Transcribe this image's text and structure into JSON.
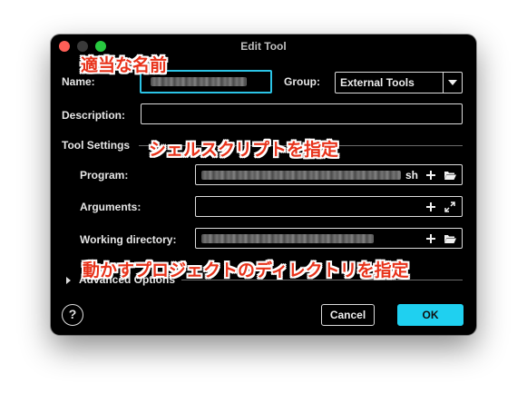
{
  "window": {
    "title": "Edit Tool"
  },
  "form": {
    "name_label": "Name:",
    "group_label": "Group:",
    "group_value": "External Tools",
    "description_label": "Description:",
    "description_value": "",
    "tool_settings_label": "Tool Settings",
    "program_label": "Program:",
    "program_suffix": "sh",
    "arguments_label": "Arguments:",
    "arguments_value": "",
    "working_dir_label": "Working directory:",
    "advanced_label": "Advanced Options"
  },
  "buttons": {
    "help": "?",
    "cancel": "Cancel",
    "ok": "OK"
  },
  "annotations": {
    "name_note": "適当な名前",
    "script_note": "シェルスクリプトを指定",
    "dir_note": "動かすプロジェクトのディレクトリを指定"
  },
  "icons": [
    "add-icon",
    "folder-open-icon",
    "expand-icon",
    "chevron-down-icon",
    "disclosure-triangle-icon",
    "help-icon"
  ],
  "colors": {
    "accent": "#1fd0f0",
    "annotation": "#e8321a",
    "background": "#000000"
  }
}
